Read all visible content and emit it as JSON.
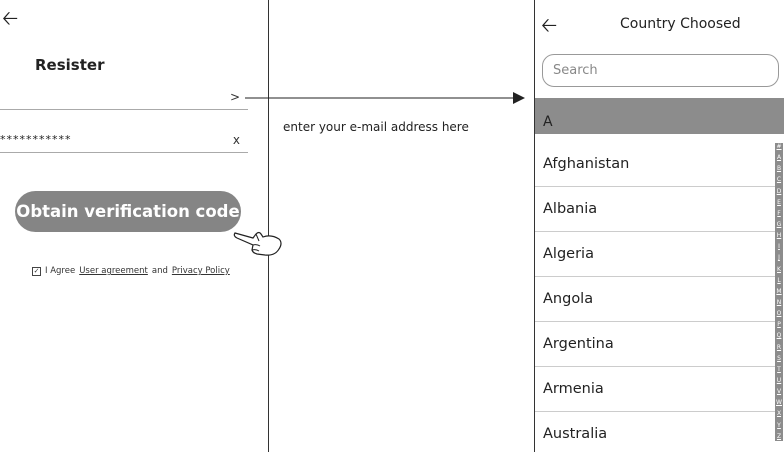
{
  "left_screen": {
    "back_icon": "left-arrow",
    "title": "Resister",
    "email_action": ">",
    "password_value": "***********",
    "password_clear": "x",
    "obtain_button": "Obtain verification code",
    "pointer_icon": "hand-pointer",
    "agreement": {
      "prefix": "I Agree",
      "user_agreement": "User agreement",
      "and": "and",
      "privacy_policy": "Privacy Policy"
    }
  },
  "annotation": "enter your e-mail address here",
  "right_screen": {
    "back_icon": "left-arrow",
    "title": "Country Choosed",
    "search_placeholder": "Search",
    "section": "A",
    "countries": [
      "Afghanistan",
      "Albania",
      "Algeria",
      "Angola",
      "Argentina",
      "Armenia",
      "Australia"
    ],
    "index_letters": [
      "#",
      "A",
      "B",
      "C",
      "D",
      "E",
      "F",
      "G",
      "H",
      "I",
      "J",
      "K",
      "L",
      "M",
      "N",
      "O",
      "P",
      "Q",
      "R",
      "S",
      "T",
      "U",
      "V",
      "W",
      "X",
      "Y",
      "Z"
    ]
  },
  "colors": {
    "button_gray": "#858585",
    "header_gray": "#8c8c8c",
    "text": "#222222"
  }
}
